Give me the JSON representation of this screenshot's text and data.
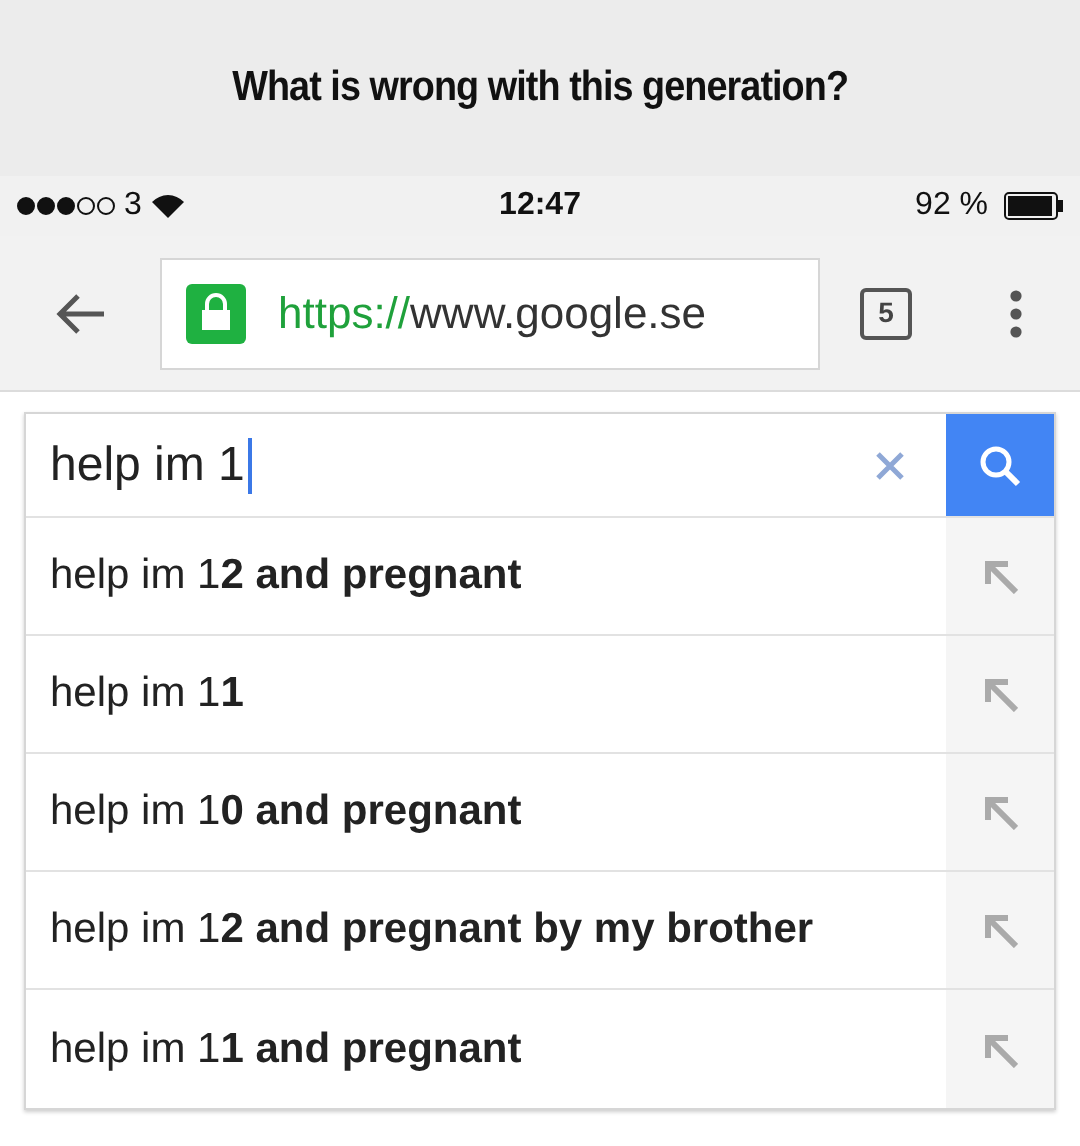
{
  "caption": "What is wrong with this generation?",
  "status_bar": {
    "carrier": "3",
    "time": "12:47",
    "battery": "92 %"
  },
  "browser": {
    "url_scheme": "https://",
    "url_host": "www.google.se",
    "tab_count": "5"
  },
  "search": {
    "value": "help im 1"
  },
  "suggestions": [
    {
      "text": "help im 1**2 and pregnant**"
    },
    {
      "text": "help im 1**1**"
    },
    {
      "text": "help im 1**0 and pregnant**"
    },
    {
      "text": "help im 1**2 and pregnant by my brother**"
    },
    {
      "text": "help im 1**1 and pregnant**"
    }
  ]
}
